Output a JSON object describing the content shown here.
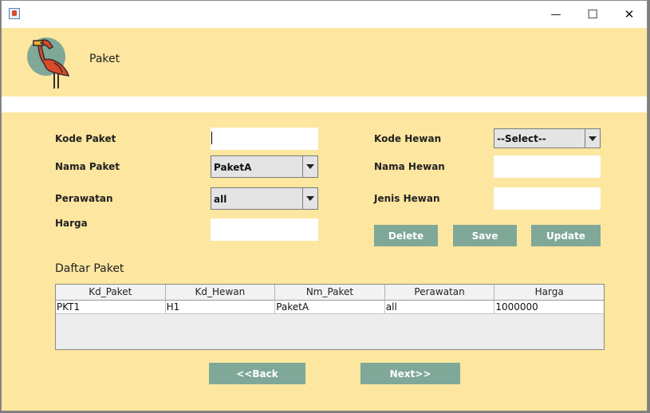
{
  "window": {
    "minimize_glyph": "—",
    "maximize_glyph": "☐",
    "close_glyph": "✕"
  },
  "header": {
    "title": "Paket"
  },
  "form": {
    "kode_paket": {
      "label": "Kode Paket",
      "value": ""
    },
    "nama_paket": {
      "label": "Nama Paket",
      "value": "PaketA"
    },
    "perawatan": {
      "label": "Perawatan",
      "value": "all"
    },
    "harga": {
      "label": "Harga",
      "value": ""
    },
    "kode_hewan": {
      "label": "Kode Hewan",
      "value": "--Select--"
    },
    "nama_hewan": {
      "label": "Nama Hewan",
      "value": ""
    },
    "jenis_hewan": {
      "label": "Jenis Hewan",
      "value": ""
    }
  },
  "actions": {
    "delete": "Delete",
    "save": "Save",
    "update": "Update"
  },
  "table": {
    "title": "Daftar Paket",
    "columns": [
      "Kd_Paket",
      "Kd_Hewan",
      "Nm_Paket",
      "Perawatan",
      "Harga"
    ],
    "rows": [
      [
        "PKT1",
        "H1",
        "PaketA",
        "all",
        "1000000"
      ]
    ]
  },
  "nav": {
    "back": "<<Back",
    "next": "Next>>"
  },
  "colors": {
    "background": "#fde69f",
    "button": "#7fa898"
  }
}
